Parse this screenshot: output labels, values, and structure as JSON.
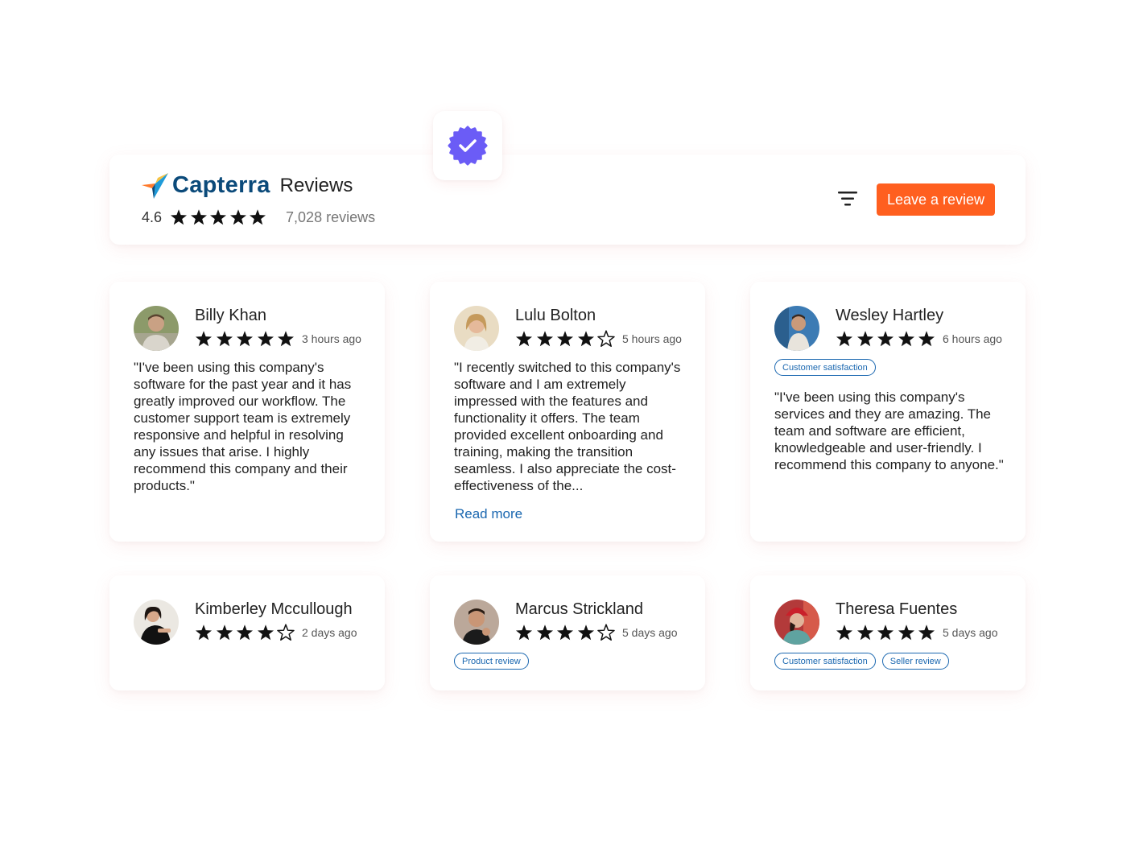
{
  "header": {
    "brand": "Capterra",
    "suffix": "Reviews",
    "rating": "4.6",
    "rating_value": 5,
    "review_count": "7,028 reviews",
    "leave_review_label": "Leave a review",
    "accent_color": "#ff5f1f",
    "brand_color": "#0b4a7a",
    "verified_badge_color": "#6b5cf6",
    "icons": [
      "capterra-logo-icon",
      "verified-badge-icon",
      "filter-icon"
    ]
  },
  "reviews": [
    {
      "name": "Billy Khan",
      "stars": 5,
      "time": "3 hours ago",
      "tags": [],
      "text": "\"I've been using this company's software for the past year and it has greatly improved our workflow. The customer support team is extremely responsive and helpful in resolving any issues that arise. I highly recommend this company and their products.\"",
      "read_more": ""
    },
    {
      "name": "Lulu Bolton",
      "stars": 4,
      "time": "5 hours ago",
      "tags": [],
      "text": "\"I recently switched to this company's software and I am extremely impressed with the features and functionality it offers. The team provided excellent onboarding and training, making the transition seamless. I also appreciate the cost-effectiveness of the...",
      "read_more": "Read more"
    },
    {
      "name": "Wesley Hartley",
      "stars": 5,
      "time": "6 hours ago",
      "tags": [
        "Customer satisfaction"
      ],
      "text": "\"I've been using this company's services and they are amazing. The team and software are efficient, knowledgeable and user-friendly. I recommend this company to anyone.\"",
      "read_more": ""
    },
    {
      "name": "Kimberley Mccullough",
      "stars": 4,
      "time": "2 days ago",
      "tags": [],
      "text": "",
      "read_more": ""
    },
    {
      "name": "Marcus Strickland",
      "stars": 4,
      "time": "5 days ago",
      "tags": [
        "Product review"
      ],
      "text": "",
      "read_more": ""
    },
    {
      "name": "Theresa Fuentes",
      "stars": 5,
      "time": "5 days ago",
      "tags": [
        "Customer satisfaction",
        "Seller review"
      ],
      "text": "",
      "read_more": ""
    }
  ]
}
